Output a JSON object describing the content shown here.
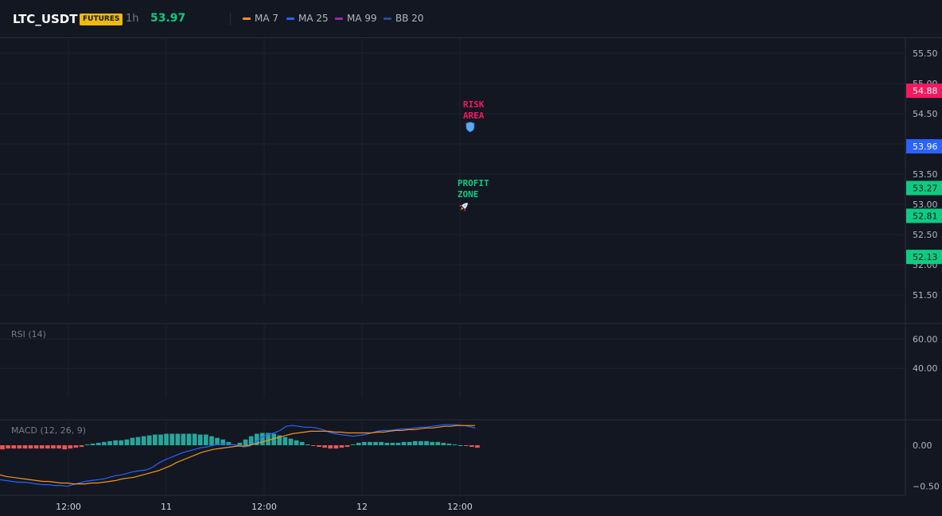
{
  "header": {
    "symbol": "LTC_USDT",
    "badge": "FUTURES",
    "interval": "1h",
    "last_price": "53.97",
    "indicators": [
      {
        "label": "MA 7",
        "color": "#f7931a"
      },
      {
        "label": "MA 25",
        "color": "#2962ff"
      },
      {
        "label": "MA 99",
        "color": "#9c27b0"
      },
      {
        "label": "BB 20",
        "color": "#2a4a9a"
      }
    ]
  },
  "price_pane": {
    "y_ticks": [
      "55.50",
      "55.00",
      "54.50",
      "54.00",
      "53.50",
      "53.00",
      "52.50",
      "52.00",
      "51.50"
    ],
    "price_tags": [
      {
        "value": "54.88",
        "color": "#f6185e"
      },
      {
        "value": "53.96",
        "color": "#2962ff"
      },
      {
        "value": "53.27",
        "color": "#0ecb81"
      },
      {
        "value": "52.81",
        "color": "#0ecb81"
      },
      {
        "value": "52.13",
        "color": "#0ecb81"
      }
    ],
    "annotations": [
      {
        "line1": "RISK",
        "line2": "AREA",
        "icon": "shield-icon",
        "color": "#f6185e"
      },
      {
        "line1": "PROFIT",
        "line2": "ZONE",
        "icon": "rocket-icon",
        "color": "#0ecb81"
      }
    ]
  },
  "rsi_pane": {
    "label": "RSI (14)",
    "y_ticks": [
      "60.00",
      "40.00"
    ]
  },
  "macd_pane": {
    "label": "MACD (12, 26, 9)",
    "y_ticks": [
      "0.00",
      "−0.50"
    ]
  },
  "x_axis": {
    "labels": [
      "12:00",
      "11",
      "12:00",
      "12",
      "12:00"
    ]
  },
  "chart_data": [
    {
      "type": "line",
      "title": "",
      "ylim": [
        51.25,
        55.75
      ],
      "y_ticks": [
        55.5,
        55.0,
        54.5,
        54.0,
        53.5,
        53.0,
        52.5,
        52.0,
        51.5
      ],
      "price_levels": [
        54.88,
        53.96,
        53.27,
        52.81,
        52.13
      ],
      "series": []
    },
    {
      "type": "line",
      "title": "",
      "ylim": [
        20,
        70
      ],
      "y_ticks": [
        60,
        40
      ],
      "series": []
    },
    {
      "type": "bar",
      "title": "",
      "ylim": [
        -0.6,
        0.3
      ],
      "y_ticks": [
        0.0,
        -0.5
      ],
      "histogram": [
        -0.05,
        -0.04,
        -0.04,
        -0.04,
        -0.04,
        -0.04,
        -0.04,
        -0.04,
        -0.04,
        -0.04,
        -0.04,
        -0.05,
        -0.04,
        -0.03,
        -0.02,
        0.01,
        0.02,
        0.03,
        0.04,
        0.05,
        0.06,
        0.06,
        0.07,
        0.09,
        0.1,
        0.11,
        0.12,
        0.13,
        0.13,
        0.14,
        0.14,
        0.14,
        0.14,
        0.14,
        0.14,
        0.13,
        0.13,
        0.11,
        0.09,
        0.07,
        0.04,
        0.01,
        0.03,
        0.07,
        0.11,
        0.14,
        0.15,
        0.15,
        0.14,
        0.12,
        0.1,
        0.08,
        0.06,
        0.04,
        0.01,
        -0.01,
        -0.02,
        -0.03,
        -0.04,
        -0.04,
        -0.03,
        -0.02,
        0.01,
        0.03,
        0.04,
        0.04,
        0.04,
        0.04,
        0.03,
        0.03,
        0.03,
        0.04,
        0.04,
        0.05,
        0.05,
        0.05,
        0.04,
        0.04,
        0.03,
        0.02,
        0.01,
        0.0,
        -0.01,
        -0.02,
        -0.03
      ],
      "series": [
        {
          "values": [
            -0.42,
            -0.43,
            -0.44,
            -0.45,
            -0.45,
            -0.46,
            -0.47,
            -0.48,
            -0.48,
            -0.49,
            -0.49,
            -0.5,
            -0.48,
            -0.46,
            -0.44,
            -0.43,
            -0.42,
            -0.41,
            -0.39,
            -0.37,
            -0.36,
            -0.34,
            -0.32,
            -0.31,
            -0.3,
            -0.27,
            -0.22,
            -0.18,
            -0.15,
            -0.12,
            -0.09,
            -0.07,
            -0.05,
            -0.03,
            -0.02,
            0.0,
            0.01,
            0.02,
            0.01,
            0.0,
            -0.02,
            -0.01,
            0.04,
            0.1,
            0.13,
            0.15,
            0.18,
            0.23,
            0.24,
            0.23,
            0.22,
            0.22,
            0.21,
            0.19,
            0.16,
            0.14,
            0.13,
            0.12,
            0.11,
            0.12,
            0.13,
            0.15,
            0.17,
            0.18,
            0.18,
            0.19,
            0.2,
            0.2,
            0.21,
            0.22,
            0.22,
            0.23,
            0.24,
            0.25,
            0.25,
            0.25,
            0.24,
            0.23,
            0.21
          ]
        },
        {
          "values": [
            -0.36,
            -0.38,
            -0.39,
            -0.4,
            -0.41,
            -0.42,
            -0.43,
            -0.44,
            -0.44,
            -0.45,
            -0.46,
            -0.46,
            -0.47,
            -0.47,
            -0.47,
            -0.46,
            -0.46,
            -0.45,
            -0.44,
            -0.43,
            -0.41,
            -0.4,
            -0.39,
            -0.37,
            -0.35,
            -0.33,
            -0.31,
            -0.28,
            -0.25,
            -0.21,
            -0.18,
            -0.15,
            -0.12,
            -0.09,
            -0.07,
            -0.05,
            -0.04,
            -0.03,
            -0.02,
            -0.01,
            -0.01,
            0.0,
            0.02,
            0.04,
            0.06,
            0.08,
            0.1,
            0.12,
            0.14,
            0.15,
            0.16,
            0.17,
            0.17,
            0.17,
            0.17,
            0.16,
            0.16,
            0.15,
            0.15,
            0.15,
            0.15,
            0.15,
            0.16,
            0.16,
            0.17,
            0.18,
            0.18,
            0.19,
            0.19,
            0.2,
            0.21,
            0.21,
            0.22,
            0.23,
            0.23,
            0.24,
            0.24,
            0.24,
            0.24
          ]
        }
      ]
    }
  ]
}
